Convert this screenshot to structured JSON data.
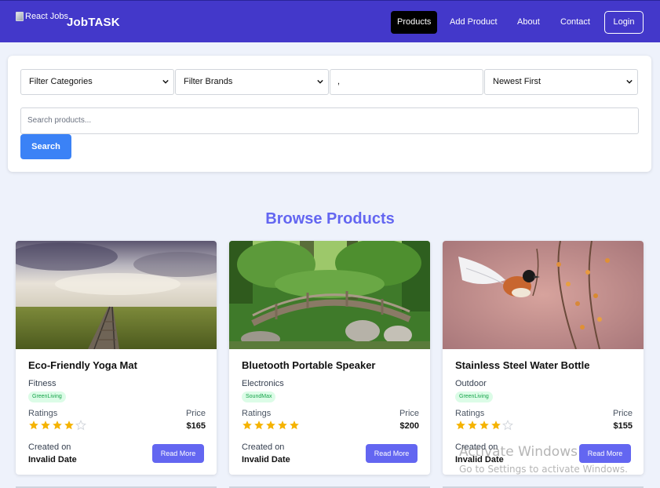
{
  "navbar": {
    "logo_alt": "React Jobs",
    "brand": "JobTASK",
    "links": [
      {
        "label": "Products",
        "active": true
      },
      {
        "label": "Add Product",
        "active": false
      },
      {
        "label": "About",
        "active": false
      },
      {
        "label": "Contact",
        "active": false
      }
    ],
    "login_label": "Login",
    "background_color": "#4338ca"
  },
  "filters": {
    "category_selected": "Filter Categories",
    "brand_selected": "Filter Brands",
    "price_range_value": ",",
    "sort_selected": "Newest First",
    "search_placeholder": "Search products...",
    "search_button": "Search"
  },
  "section_title": "Browse Products",
  "products": [
    {
      "title": "Eco-Friendly Yoga Mat",
      "category": "Fitness",
      "brand": "GreenLiving",
      "ratings_label": "Ratings",
      "rating": 4,
      "price_label": "Price",
      "price": "$165",
      "created_label": "Created on",
      "created_value": "Invalid Date",
      "button": "Read More",
      "image_icon": "railway-landscape-photo"
    },
    {
      "title": "Bluetooth Portable Speaker",
      "category": "Electronics",
      "brand": "SoundMax",
      "ratings_label": "Ratings",
      "rating": 5,
      "price_label": "Price",
      "price": "$200",
      "created_label": "Created on",
      "created_value": "Invalid Date",
      "button": "Read More",
      "image_icon": "garden-bridge-photo"
    },
    {
      "title": "Stainless Steel Water Bottle",
      "category": "Outdoor",
      "brand": "GreenLiving",
      "ratings_label": "Ratings",
      "rating": 4,
      "price_label": "Price",
      "price": "$155",
      "created_label": "Created on",
      "created_value": "Invalid Date",
      "button": "Read More",
      "image_icon": "bird-branch-photo"
    }
  ],
  "watermark": {
    "title": "Activate Windows",
    "subtitle": "Go to Settings to activate Windows."
  },
  "colors": {
    "accent": "#6366f1",
    "search_button": "#3b82f6",
    "star_filled": "#f5b301",
    "star_empty": "#d1d5db"
  }
}
